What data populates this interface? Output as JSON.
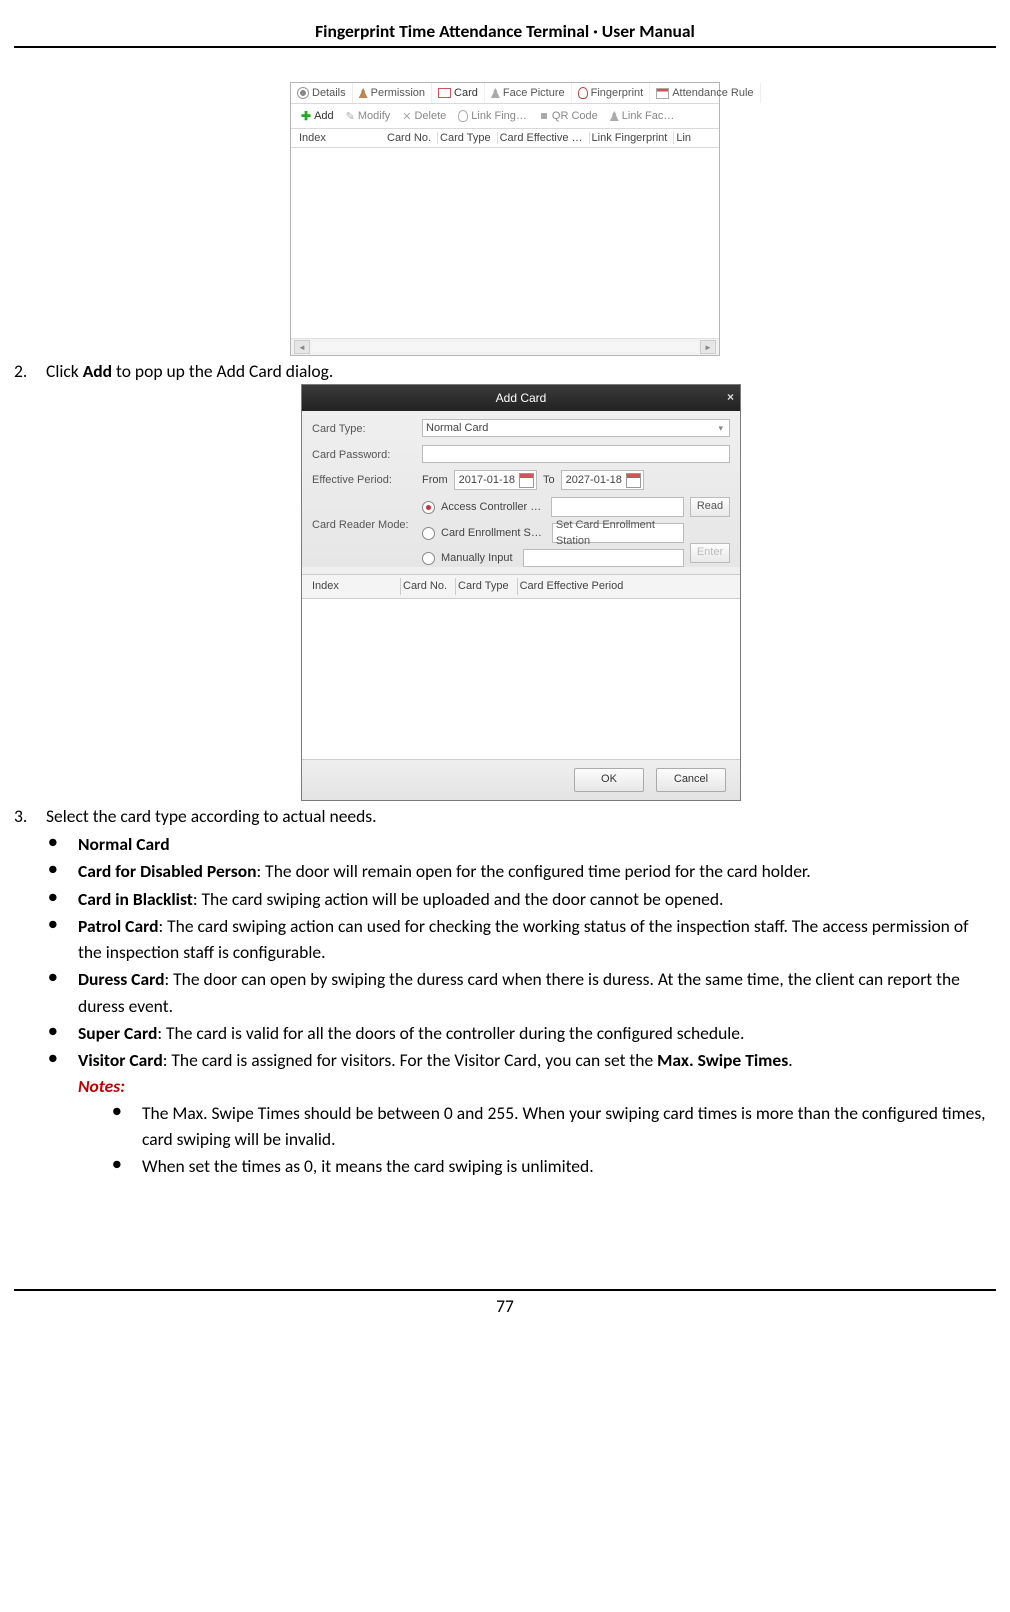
{
  "header": {
    "title": "Fingerprint Time Attendance Terminal · User Manual"
  },
  "footer": {
    "page": "77"
  },
  "step2": {
    "num": "2.",
    "pre": "Click ",
    "bold": "Add",
    "post": " to pop up the Add Card dialog."
  },
  "step3": {
    "num": "3.",
    "text": "Select the card type according to actual needs."
  },
  "cards": {
    "normal": {
      "b": "Normal Card"
    },
    "disabled": {
      "b": "Card for Disabled Person",
      "rest": ": The door will remain open for the configured time period for the card holder."
    },
    "blacklist": {
      "b": "Card in Blacklist",
      "rest": ": The card swiping action will be uploaded and the door cannot be opened."
    },
    "patrol": {
      "b": "Patrol Card",
      "rest": ": The card swiping action can used for checking the working status of the inspection staff. The access permission of the inspection staff is configurable."
    },
    "duress": {
      "b": "Duress Card",
      "rest": ": The door can open by swiping the duress card when there is duress. At the same time, the client can report the duress event."
    },
    "super": {
      "b": "Super Card",
      "rest": ": The card is valid for all the doors of the controller during the configured schedule."
    },
    "visitor": {
      "b": "Visitor Card",
      "mid": ": The card is assigned for visitors. For the Visitor Card, you can set the ",
      "b2": "Max. Swipe Times",
      "end": ".",
      "notes_label": "Notes:",
      "note1": "The Max. Swipe Times should be between 0 and 255. When your swiping card times is more than the configured times, card swiping will be invalid.",
      "note2": "When set the times as 0, it means the card swiping is unlimited."
    }
  },
  "fig1": {
    "tabs": [
      "Details",
      "Permission",
      "Card",
      "Face Picture",
      "Fingerprint",
      "Attendance Rule"
    ],
    "toolbar": {
      "add": "Add",
      "modify": "Modify",
      "delete": "Delete",
      "linkfing": "Link Fing…",
      "qr": "QR Code",
      "linkfac": "Link Fac…"
    },
    "cols": [
      "Index",
      "Card No.",
      "Card Type",
      "Card Effective …",
      "Link Fingerprint",
      "Lin"
    ]
  },
  "fig2": {
    "title": "Add Card",
    "labels": {
      "cardtype": "Card Type:",
      "cardpw": "Card Password:",
      "effperiod": "Effective Period:",
      "readermode": "Card Reader Mode:"
    },
    "cardtype_value": "Normal Card",
    "from": "From",
    "to": "To",
    "date_from": "2017-01-18",
    "date_to": "2027-01-18",
    "radios": {
      "access": "Access Controller …",
      "enroll": "Card Enrollment S…",
      "manual": "Manually Input"
    },
    "enroll_field": "Set Card Enrollment Station",
    "btn_read": "Read",
    "btn_enter": "Enter",
    "cols": [
      "Index",
      "Card No.",
      "Card Type",
      "Card Effective Period"
    ],
    "ok": "OK",
    "cancel": "Cancel"
  }
}
